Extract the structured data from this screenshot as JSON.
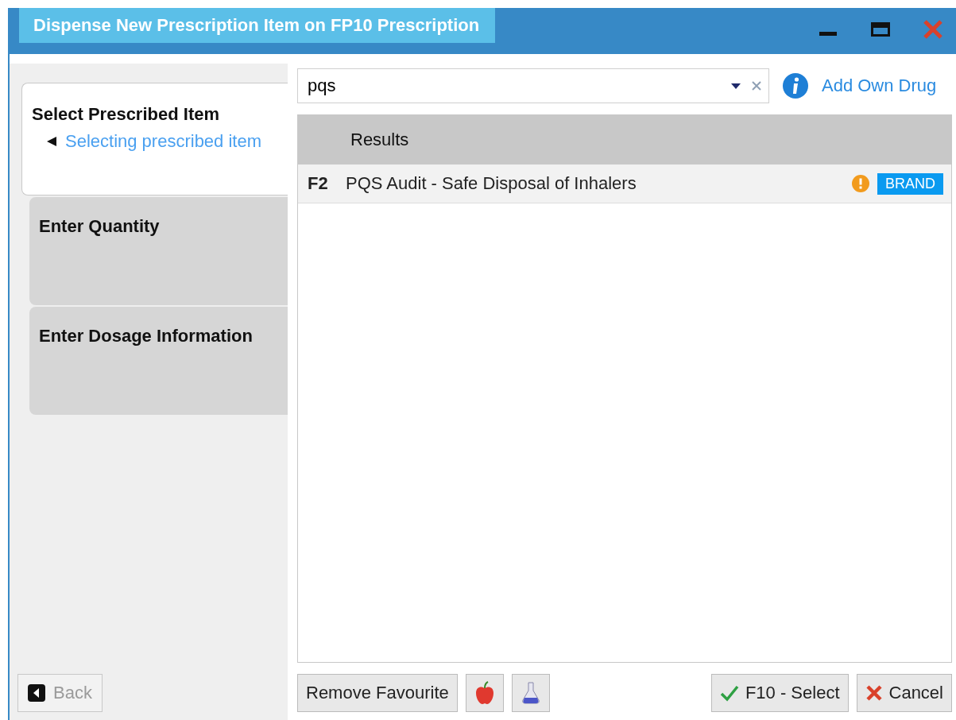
{
  "window": {
    "title": "Dispense New Prescription Item on FP10 Prescription"
  },
  "steps": [
    {
      "label": "Select Prescribed Item",
      "status": "Selecting prescribed item",
      "selected": true
    },
    {
      "label": "Enter Quantity",
      "selected": false
    },
    {
      "label": "Enter Dosage Information",
      "selected": false
    }
  ],
  "back_button": {
    "label": "Back",
    "disabled": true
  },
  "search": {
    "value": "pqs"
  },
  "add_own_drug": "Add Own Drug",
  "results": {
    "header": "Results",
    "rows": [
      {
        "key": "F2",
        "name": "PQS Audit - Safe Disposal of Inhalers",
        "warning": true,
        "badge": "BRAND",
        "selected": false
      }
    ]
  },
  "footer_buttons": [
    {
      "kind": "text",
      "label": "Remove Favourite"
    },
    {
      "kind": "apple"
    },
    {
      "kind": "flask"
    },
    {
      "kind": "select",
      "label": "F10 - Select"
    },
    {
      "kind": "cancel",
      "label": "Cancel"
    }
  ]
}
